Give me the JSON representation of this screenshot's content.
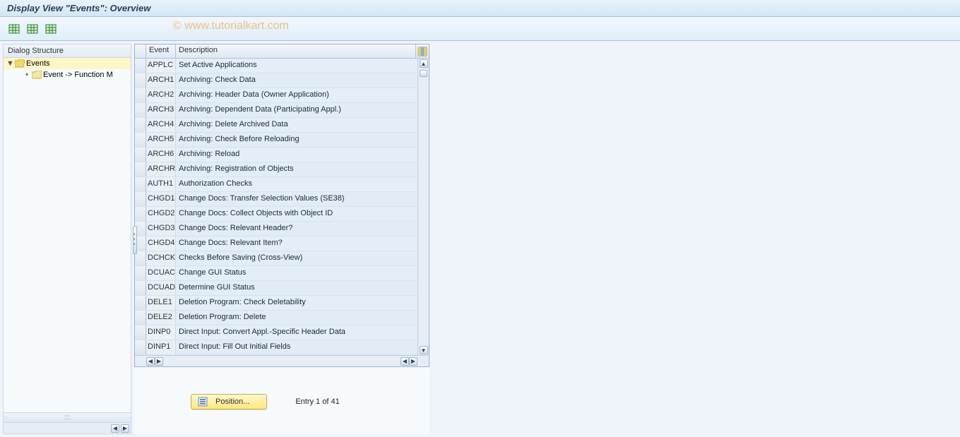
{
  "title": "Display View \"Events\": Overview",
  "watermark": "© www.tutorialkart.com",
  "toolbar": {
    "btn1_name": "table-action-1-icon",
    "btn2_name": "table-action-2-icon",
    "btn3_name": "table-action-3-icon"
  },
  "dialog_structure": {
    "header": "Dialog Structure",
    "items": [
      {
        "label": "Events",
        "selected": true,
        "expanded": true,
        "open_folder": true
      },
      {
        "label": "Event -> Function M",
        "selected": false,
        "child": true,
        "open_folder": false
      }
    ]
  },
  "grid": {
    "columns": {
      "event": "Event",
      "description": "Description"
    },
    "rows": [
      {
        "event": "APPLC",
        "desc": "Set Active Applications"
      },
      {
        "event": "ARCH1",
        "desc": "Archiving: Check Data"
      },
      {
        "event": "ARCH2",
        "desc": "Archiving: Header Data (Owner Application)"
      },
      {
        "event": "ARCH3",
        "desc": "Archiving: Dependent Data (Participating Appl.)"
      },
      {
        "event": "ARCH4",
        "desc": "Archiving: Delete Archived Data"
      },
      {
        "event": "ARCH5",
        "desc": "Archiving: Check Before Reloading"
      },
      {
        "event": "ARCH6",
        "desc": "Archiving: Reload"
      },
      {
        "event": "ARCHR",
        "desc": "Archiving: Registration of Objects"
      },
      {
        "event": "AUTH1",
        "desc": "Authorization Checks"
      },
      {
        "event": "CHGD1",
        "desc": "Change Docs: Transfer Selection Values (SE38)"
      },
      {
        "event": "CHGD2",
        "desc": "Change Docs: Collect Objects with Object ID"
      },
      {
        "event": "CHGD3",
        "desc": "Change Docs: Relevant Header?"
      },
      {
        "event": "CHGD4",
        "desc": "Change Docs: Relevant Item?"
      },
      {
        "event": "DCHCK",
        "desc": "Checks Before Saving (Cross-View)"
      },
      {
        "event": "DCUAC",
        "desc": "Change GUI Status"
      },
      {
        "event": "DCUAD",
        "desc": "Determine GUI Status"
      },
      {
        "event": "DELE1",
        "desc": "Deletion Program: Check Deletability"
      },
      {
        "event": "DELE2",
        "desc": "Deletion Program: Delete"
      },
      {
        "event": "DINP0",
        "desc": "Direct Input: Convert Appl.-Specific Header Data"
      },
      {
        "event": "DINP1",
        "desc": "Direct Input: Fill Out Initial Fields"
      }
    ]
  },
  "footer": {
    "position_label": "Position...",
    "entry_text": "Entry 1 of 41"
  }
}
